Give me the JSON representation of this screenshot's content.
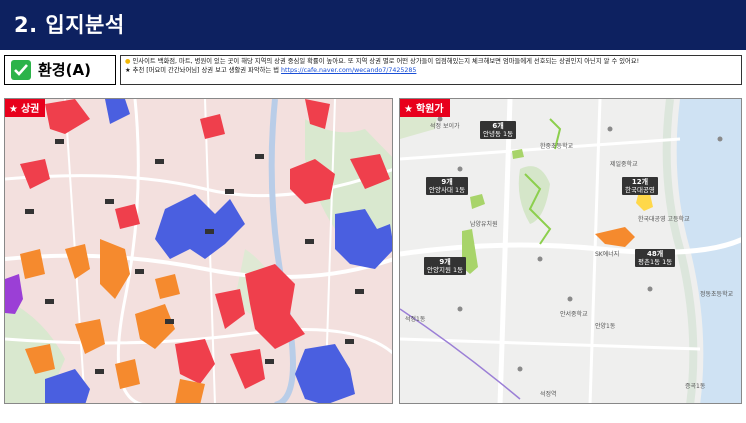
{
  "header": {
    "title": "2. 입지분석"
  },
  "environment": {
    "label": "환경(A)"
  },
  "note": {
    "line1": "인사이트 백화점, 마트, 병원이 있는 곳이 해당 지역의 상권 중심일 확률이 높아요. 또 지역 상권 별로 어떤 상가들이 입점해있는지 체크해보면 엄마들에게 선호되는 상권인지 아닌지 알 수 있어요!",
    "line2_prefix": "추천 [머요미 간간놔어님] 상권 보고 생활권 파악하는 법",
    "link": "https://cafe.naver.com/wecando7/7425285"
  },
  "panels": {
    "left_tag": "상권",
    "right_tag": "학원가"
  },
  "academies": [
    {
      "count": "6개",
      "name": "안녕동 1동"
    },
    {
      "count": "9개",
      "name": "안양사대 1동"
    },
    {
      "count": "12개",
      "name": "한국대공영"
    },
    {
      "count": "9개",
      "name": "안양지원 1동"
    },
    {
      "count": "48개",
      "name": "평촌1동 1동"
    }
  ],
  "right_places": [
    "석정 보이가",
    "한중초등학교",
    "남양유치원",
    "제일중학교",
    "안서중학교",
    "정동초등학교",
    "SK에너지",
    "석정1동",
    "안양1동",
    "증곡1동",
    "한국대공영 고등학교",
    "석정역"
  ],
  "colors": {
    "header": "#0d2160",
    "tag": "#e8001c",
    "check": "#2cb34a"
  }
}
